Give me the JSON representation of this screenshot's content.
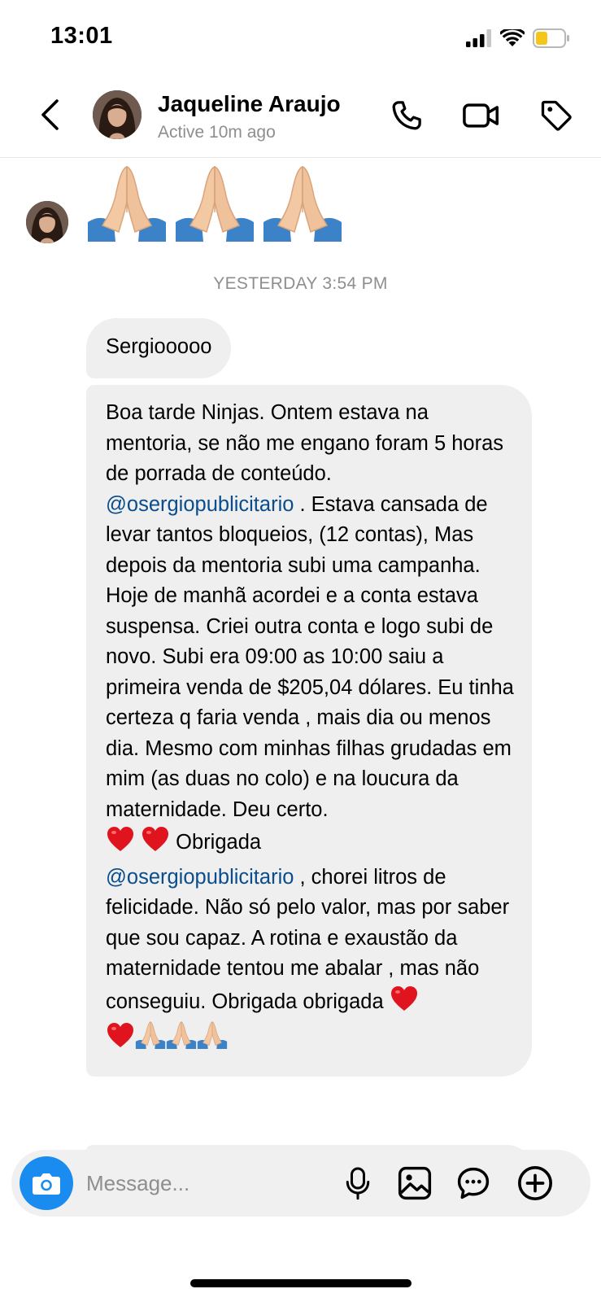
{
  "status_bar": {
    "time": "13:01",
    "icons": [
      "cellular-signal-icon",
      "wifi-icon",
      "battery-low-icon"
    ],
    "battery_color": "#f5c518"
  },
  "header": {
    "contact_name": "Jaqueline Araujo",
    "contact_status": "Active 10m ago",
    "icons": [
      "back-arrow-icon",
      "phone-icon",
      "video-camera-icon",
      "tag-icon"
    ]
  },
  "chat": {
    "emoji_message": [
      "🙏🏼",
      "🙏🏼",
      "🙏🏼"
    ],
    "timestamp": "YESTERDAY 3:54 PM",
    "messages": [
      {
        "text": "Sergiooooo"
      },
      {
        "text_parts": {
          "p1": "Boa tarde Ninjas. Ontem estava na mentoria, se não me engano foram 5 horas de porrada de conteúdo. ",
          "mention1": "@osergiopublicitario",
          "p2": " . Estava cansada de levar tantos bloqueios, (12 contas), Mas depois da mentoria subi uma campanha. Hoje de manhã acordei e a conta estava suspensa. Criei outra conta e logo subi de novo. Subi era 09:00 as 10:00 saiu a primeira venda de $205,04 dólares. Eu tinha certeza q faria venda , mais dia ou menos dia. Mesmo com minhas filhas grudadas em mim (as duas no colo) e na loucura da maternidade. Deu certo. ",
          "p3": " Obrigada ",
          "mention2": "@osergiopublicitario",
          "p4": " , chorei litros de felicidade. Não só pelo valor, mas por saber que sou capaz. A rotina e exaustão da maternidade tentou me abalar , mas não conseguiu. Obrigada obrigada "
        },
        "emojis": [
          "❤️",
          "🙏🏼"
        ]
      }
    ],
    "mention_color": "#0a4d8c",
    "bubble_color": "#efefef"
  },
  "composer": {
    "placeholder": "Message...",
    "icons": [
      "camera-icon",
      "microphone-icon",
      "image-icon",
      "sticker-icon",
      "plus-circle-icon"
    ],
    "camera_color": "#1a8cf0"
  }
}
